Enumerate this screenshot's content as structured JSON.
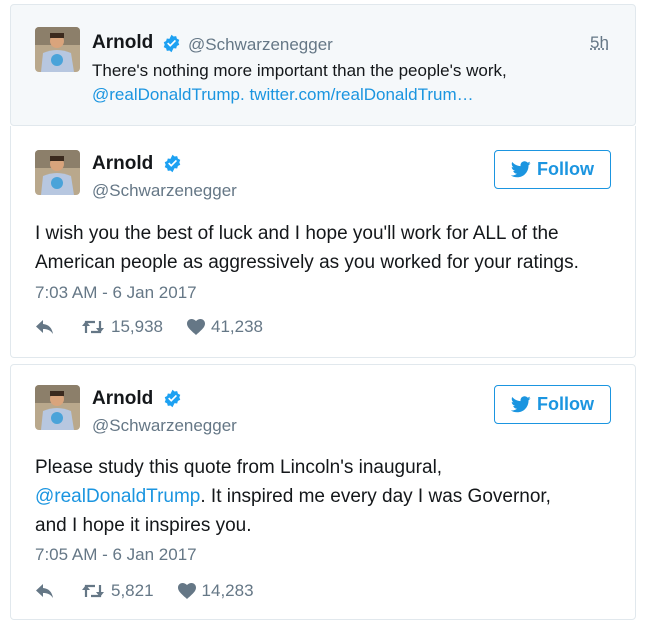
{
  "reply_tweet": {
    "name": "Arnold",
    "handle": "@Schwarzenegger",
    "time": "5h",
    "text_part1": "There's nothing more important than the people's work,",
    "mention": "@realDonaldTrump",
    "link_sep": ".",
    "url": "twitter.com/realDonaldTrum…"
  },
  "tweet1": {
    "name": "Arnold",
    "handle": "@Schwarzenegger",
    "follow_label": "Follow",
    "text_line1": "I wish you the best of luck and I hope you'll work for ALL of the",
    "text_line2": "American people as aggressively as you worked for your ratings.",
    "timestamp": "7:03 AM - 6 Jan 2017",
    "retweets": "15,938",
    "likes": "41,238"
  },
  "tweet2": {
    "name": "Arnold",
    "handle": "@Schwarzenegger",
    "follow_label": "Follow",
    "text_line1": "Please study this quote from Lincoln's inaugural,",
    "mention": "@realDonaldTrump",
    "text_line2_rest": ". It inspired me every day I was Governor,",
    "text_line3": "and I hope it inspires you.",
    "timestamp": "7:05 AM - 6 Jan 2017",
    "retweets": "5,821",
    "likes": "14,283"
  },
  "colors": {
    "link": "#1b95e0",
    "verified": "#1da1f2",
    "muted": "#657786"
  }
}
